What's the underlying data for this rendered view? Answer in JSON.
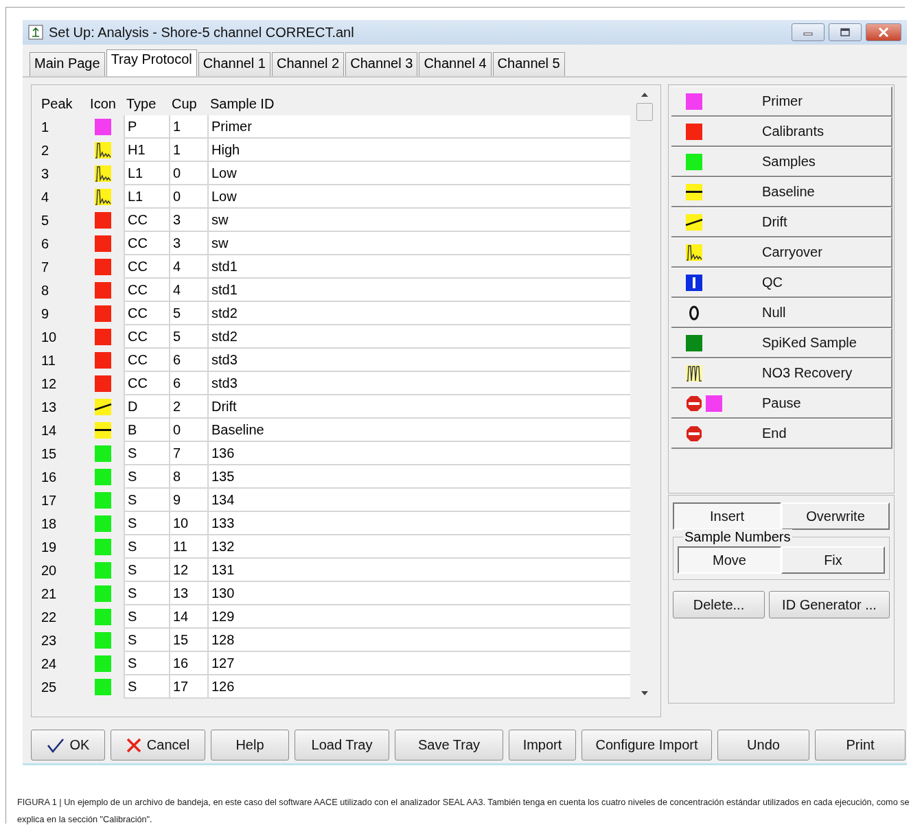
{
  "window": {
    "title": "Set Up: Analysis - Shore-5 channel CORRECT.anl"
  },
  "tabs": [
    {
      "label": "Main Page",
      "selected": false
    },
    {
      "label": "Tray Protocol",
      "selected": true
    },
    {
      "label": "Channel 1",
      "selected": false
    },
    {
      "label": "Channel 2",
      "selected": false
    },
    {
      "label": "Channel 3",
      "selected": false
    },
    {
      "label": "Channel 4",
      "selected": false
    },
    {
      "label": "Channel 5",
      "selected": false
    }
  ],
  "table": {
    "columns": [
      "Peak",
      "Icon",
      "Type",
      "Cup",
      "Sample ID"
    ],
    "rows": [
      {
        "peak": "1",
        "kind": "primer",
        "type": "P",
        "cup": "1",
        "sample_id": "Primer"
      },
      {
        "peak": "2",
        "kind": "carryover",
        "type": "H1",
        "cup": "1",
        "sample_id": "High"
      },
      {
        "peak": "3",
        "kind": "carryover",
        "type": "L1",
        "cup": "0",
        "sample_id": "Low"
      },
      {
        "peak": "4",
        "kind": "carryover",
        "type": "L1",
        "cup": "0",
        "sample_id": "Low"
      },
      {
        "peak": "5",
        "kind": "calibrant",
        "type": "CC",
        "cup": "3",
        "sample_id": "sw"
      },
      {
        "peak": "6",
        "kind": "calibrant",
        "type": "CC",
        "cup": "3",
        "sample_id": "sw"
      },
      {
        "peak": "7",
        "kind": "calibrant",
        "type": "CC",
        "cup": "4",
        "sample_id": "std1"
      },
      {
        "peak": "8",
        "kind": "calibrant",
        "type": "CC",
        "cup": "4",
        "sample_id": "std1"
      },
      {
        "peak": "9",
        "kind": "calibrant",
        "type": "CC",
        "cup": "5",
        "sample_id": "std2"
      },
      {
        "peak": "10",
        "kind": "calibrant",
        "type": "CC",
        "cup": "5",
        "sample_id": "std2"
      },
      {
        "peak": "11",
        "kind": "calibrant",
        "type": "CC",
        "cup": "6",
        "sample_id": "std3"
      },
      {
        "peak": "12",
        "kind": "calibrant",
        "type": "CC",
        "cup": "6",
        "sample_id": "std3"
      },
      {
        "peak": "13",
        "kind": "drift",
        "type": "D",
        "cup": "2",
        "sample_id": "Drift"
      },
      {
        "peak": "14",
        "kind": "baseline",
        "type": "B",
        "cup": "0",
        "sample_id": "Baseline"
      },
      {
        "peak": "15",
        "kind": "sample",
        "type": "S",
        "cup": "7",
        "sample_id": "136"
      },
      {
        "peak": "16",
        "kind": "sample",
        "type": "S",
        "cup": "8",
        "sample_id": "135"
      },
      {
        "peak": "17",
        "kind": "sample",
        "type": "S",
        "cup": "9",
        "sample_id": "134"
      },
      {
        "peak": "18",
        "kind": "sample",
        "type": "S",
        "cup": "10",
        "sample_id": "133"
      },
      {
        "peak": "19",
        "kind": "sample",
        "type": "S",
        "cup": "11",
        "sample_id": "132"
      },
      {
        "peak": "20",
        "kind": "sample",
        "type": "S",
        "cup": "12",
        "sample_id": "131"
      },
      {
        "peak": "21",
        "kind": "sample",
        "type": "S",
        "cup": "13",
        "sample_id": "130"
      },
      {
        "peak": "22",
        "kind": "sample",
        "type": "S",
        "cup": "14",
        "sample_id": "129"
      },
      {
        "peak": "23",
        "kind": "sample",
        "type": "S",
        "cup": "15",
        "sample_id": "128"
      },
      {
        "peak": "24",
        "kind": "sample",
        "type": "S",
        "cup": "16",
        "sample_id": "127"
      },
      {
        "peak": "25",
        "kind": "sample",
        "type": "S",
        "cup": "17",
        "sample_id": "126"
      }
    ]
  },
  "legend": [
    {
      "label": "Primer",
      "kind": "primer"
    },
    {
      "label": "Calibrants",
      "kind": "calibrant"
    },
    {
      "label": "Samples",
      "kind": "sample"
    },
    {
      "label": "Baseline",
      "kind": "baseline"
    },
    {
      "label": "Drift",
      "kind": "drift"
    },
    {
      "label": "Carryover",
      "kind": "carryover"
    },
    {
      "label": "QC",
      "kind": "qc"
    },
    {
      "label": "Null",
      "kind": "null"
    },
    {
      "label": "SpiKed Sample",
      "kind": "spiked"
    },
    {
      "label": "NO3 Recovery",
      "kind": "no3"
    },
    {
      "label": "Pause",
      "kind": "pause"
    },
    {
      "label": "End",
      "kind": "end"
    }
  ],
  "mode": [
    {
      "label": "Insert",
      "selected": true
    },
    {
      "label": "Overwrite",
      "selected": false
    }
  ],
  "sample_numbers": {
    "title": "Sample Numbers",
    "options": [
      {
        "label": "Move",
        "selected": true
      },
      {
        "label": "Fix",
        "selected": false
      }
    ]
  },
  "actions": [
    "Delete...",
    "ID Generator ..."
  ],
  "buttons": [
    {
      "label": "OK",
      "kind": "check"
    },
    {
      "label": "Cancel",
      "kind": "cross"
    },
    {
      "label": "Help"
    },
    {
      "label": "Load Tray"
    },
    {
      "label": "Save Tray"
    },
    {
      "label": "Import"
    },
    {
      "label": "Configure Import"
    },
    {
      "label": "Undo"
    },
    {
      "label": "Print"
    }
  ],
  "caption": "FIGURA 1 | Un ejemplo de un archivo de bandeja, en este caso del software AACE utilizado con el analizador SEAL AA3. También tenga en cuenta los cuatro niveles de concentración estándar utilizados en cada ejecución, como se explica en la sección \"Calibración\"."
}
